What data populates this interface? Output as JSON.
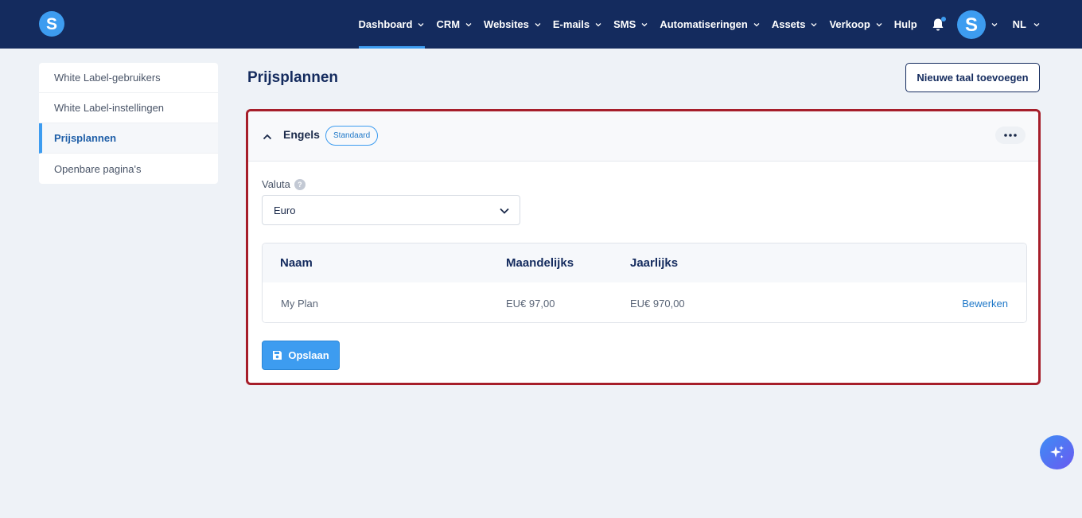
{
  "colors": {
    "topbar": "#142b5e",
    "accent": "#3d9cf0",
    "highlight_border": "#a61e2a",
    "background": "#eef2f7"
  },
  "topbar": {
    "logo_icon": "brand-s-logo",
    "nav": [
      {
        "label": "Dashboard",
        "dropdown": true,
        "active": true
      },
      {
        "label": "CRM",
        "dropdown": true
      },
      {
        "label": "Websites",
        "dropdown": true
      },
      {
        "label": "E-mails",
        "dropdown": true
      },
      {
        "label": "SMS",
        "dropdown": true
      },
      {
        "label": "Automatiseringen",
        "dropdown": true
      },
      {
        "label": "Assets",
        "dropdown": true
      },
      {
        "label": "Verkoop",
        "dropdown": true
      },
      {
        "label": "Hulp",
        "dropdown": false
      }
    ],
    "bell_icon": "bell-icon",
    "language": "NL"
  },
  "sidebar": {
    "items": [
      {
        "label": "White Label-gebruikers"
      },
      {
        "label": "White Label-instellingen"
      },
      {
        "label": "Prijsplannen",
        "active": true
      },
      {
        "label": "Openbare pagina's"
      }
    ]
  },
  "main": {
    "title": "Prijsplannen",
    "add_language_label": "Nieuwe taal toevoegen",
    "card": {
      "language": "Engels",
      "badge": "Standaard",
      "currency_label": "Valuta",
      "currency_value": "Euro",
      "table": {
        "headers": [
          "Naam",
          "Maandelijks",
          "Jaarlijks"
        ],
        "rows": [
          {
            "name": "My Plan",
            "monthly": "EU€ 97,00",
            "yearly": "EU€ 970,00",
            "action": "Bewerken"
          }
        ]
      },
      "save_label": "Opslaan"
    }
  }
}
